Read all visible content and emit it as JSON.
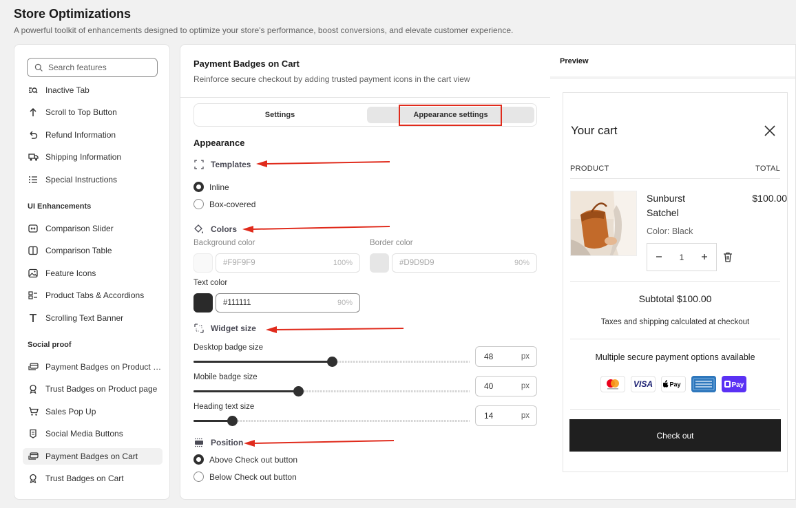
{
  "page": {
    "title": "Store Optimizations",
    "subtitle": "A powerful toolkit of enhancements designed to optimize your store's performance, boost conversions, and elevate customer experience."
  },
  "sidebar": {
    "search_placeholder": "Search features",
    "top_items": [
      {
        "label": "Inactive Tab",
        "icon": "inactive-tab-icon"
      },
      {
        "label": "Scroll to Top Button",
        "icon": "arrow-up-icon"
      },
      {
        "label": "Refund Information",
        "icon": "refund-icon"
      },
      {
        "label": "Shipping Information",
        "icon": "truck-icon"
      },
      {
        "label": "Special Instructions",
        "icon": "list-icon"
      }
    ],
    "ui_section": "UI Enhancements",
    "ui_items": [
      {
        "label": "Comparison Slider",
        "icon": "slider-icon"
      },
      {
        "label": "Comparison Table",
        "icon": "columns-icon"
      },
      {
        "label": "Feature Icons",
        "icon": "image-icon"
      },
      {
        "label": "Product Tabs & Accordions",
        "icon": "tabs-icon"
      },
      {
        "label": "Scrolling Text Banner",
        "icon": "text-icon"
      }
    ],
    "social_section": "Social proof",
    "social_items": [
      {
        "label": "Payment Badges on Product page",
        "icon": "payment-badge-icon"
      },
      {
        "label": "Trust Badges on Product page",
        "icon": "trust-badge-icon"
      },
      {
        "label": "Sales Pop Up",
        "icon": "cart-icon"
      },
      {
        "label": "Social Media Buttons",
        "icon": "social-icon"
      },
      {
        "label": "Payment Badges on Cart",
        "icon": "payment-badge-icon",
        "active": true
      },
      {
        "label": "Trust Badges on Cart",
        "icon": "trust-badge-icon"
      }
    ]
  },
  "feature": {
    "title": "Payment Badges on Cart",
    "description": "Reinforce secure checkout by adding trusted payment icons in the cart view"
  },
  "tabs": {
    "settings": "Settings",
    "appearance": "Appearance settings",
    "selected": "appearance"
  },
  "appearance": {
    "heading": "Appearance",
    "templates": {
      "label": "Templates",
      "options": [
        "Inline",
        "Box-covered"
      ],
      "selected": "Inline"
    },
    "colors": {
      "label": "Colors",
      "background_label": "Background color",
      "background_value": "#F9F9F9",
      "background_opacity": "100%",
      "border_label": "Border color",
      "border_value": "#D9D9D9",
      "border_opacity": "90%",
      "text_label": "Text color",
      "text_value": "#111111",
      "text_opacity": "90%",
      "swatch_background": "#F9F9F9",
      "swatch_border": "#E6E6E6",
      "swatch_text": "#2a2a2a"
    },
    "widget_size": {
      "label": "Widget size",
      "desktop_label": "Desktop badge size",
      "desktop_value": "48",
      "desktop_fraction": 0.5,
      "mobile_label": "Mobile badge size",
      "mobile_value": "40",
      "mobile_fraction": 0.38,
      "heading_label": "Heading text size",
      "heading_value": "14",
      "heading_fraction": 0.14,
      "unit": "px"
    },
    "position": {
      "label": "Position",
      "options": [
        "Above Check out button",
        "Below Check out button"
      ],
      "selected": "Above Check out button"
    }
  },
  "preview": {
    "title": "Preview",
    "cart_title": "Your cart",
    "col_product": "PRODUCT",
    "col_total": "TOTAL",
    "product_name": "Sunburst Satchel",
    "product_price": "$100.00",
    "product_variant": "Color: Black",
    "quantity": "1",
    "subtotal": "Subtotal $100.00",
    "taxes": "Taxes and shipping calculated at checkout",
    "payment_title": "Multiple secure payment options available",
    "badges": [
      "mastercard",
      "VISA",
      "Apple Pay",
      "American Express",
      "Google Pay"
    ],
    "checkout": "Check out"
  },
  "colors": {
    "annotation_red": "#e02b1c"
  }
}
